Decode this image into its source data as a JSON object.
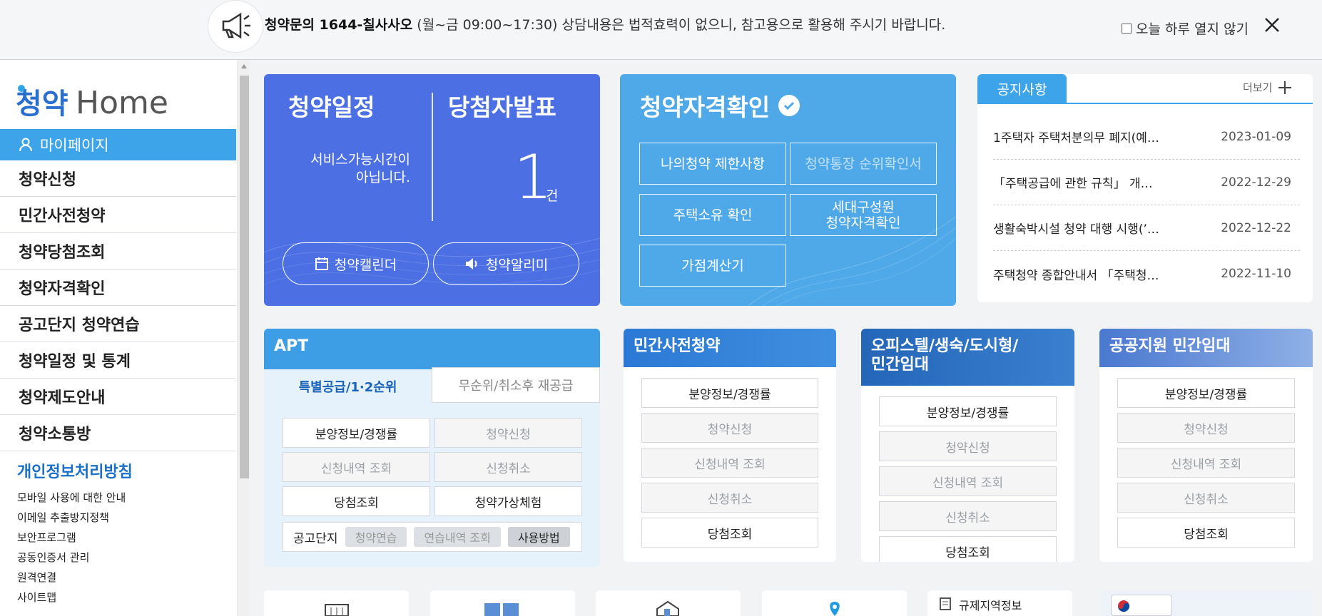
{
  "banner": {
    "headline": "청약문의 1644-칠사사오",
    "hours": "(월~금 09:00~17:30)",
    "message": "상담내용은 법적효력이 없으니, 참고용으로 활용해 주시기 바랍니다.",
    "no_open_label": "오늘 하루 열지 않기"
  },
  "sidebar": {
    "logo_text": "청약Home",
    "mypage_label": "마이페이지",
    "menu": [
      "청약신청",
      "민간사전청약",
      "청약당첨조회",
      "청약자격확인",
      "공고단지 청약연습",
      "청약일정 및 통계",
      "청약제도안내",
      "청약소통방"
    ],
    "privacy_label": "개인정보처리방침",
    "sublinks": [
      "모바일 사용에 대한 안내",
      "이메일 추출방지정책",
      "보안프로그램",
      "공동인증서 관리",
      "원격연결",
      "사이트맵"
    ]
  },
  "schedule": {
    "title": "청약일정",
    "service_msg_1": "서비스가능시간이",
    "service_msg_2": "아닙니다.",
    "winners_title": "당첨자발표",
    "winners_count": "1",
    "winners_unit": "건",
    "calendar_label": "청약캘린더",
    "alarm_label": "청약알리미"
  },
  "qualification": {
    "title": "청약자격확인",
    "buttons": [
      "나의청약 제한사항",
      "청약통장 순위확인서",
      "주택소유 확인",
      "세대구성원\n청약자격확인",
      "가점계산기"
    ]
  },
  "notices": {
    "tab_label": "공지사항",
    "more_label": "더보기",
    "items": [
      {
        "title": "1주택자 주택처분의무 폐지(예…",
        "date": "2023-01-09"
      },
      {
        "title": "「주택공급에 관한 규칙」 개…",
        "date": "2022-12-29"
      },
      {
        "title": "생활숙박시설 청약 대행 시행(’…",
        "date": "2022-12-22"
      },
      {
        "title": "주택청약 종합안내서 「주택청…",
        "date": "2022-11-10"
      }
    ]
  },
  "apt": {
    "title": "APT",
    "tab_active": "특별공급/1·2순위",
    "tab_inactive": "무순위/취소후 재공급",
    "btn_info": "분양정보/경쟁률",
    "btn_apply": "청약신청",
    "btn_history": "신청내역 조회",
    "btn_cancel": "신청취소",
    "btn_result": "당첨조회",
    "btn_virtual": "청약가상체험",
    "complex_label": "공고단지",
    "tag_practice": "청약연습",
    "tag_practice_history": "연습내역 조회",
    "tag_howto": "사용방법"
  },
  "categories": [
    {
      "title": "민간사전청약",
      "btns": [
        "분양정보/경쟁률",
        "청약신청",
        "신청내역 조회",
        "신청취소",
        "당첨조회"
      ]
    },
    {
      "title": "오피스텔/생숙/도시형/\n민간임대",
      "btns": [
        "분양정보/경쟁률",
        "청약신청",
        "신청내역 조회",
        "신청취소",
        "당첨조회"
      ]
    },
    {
      "title": "공공지원 민간임대",
      "btns": [
        "분양정보/경쟁률",
        "청약신청",
        "신청내역 조회",
        "신청취소",
        "당첨조회"
      ]
    }
  ],
  "bottom": {
    "regulation_label": "규제지역정보"
  },
  "colors": {
    "primary": "#3ea4ea",
    "schedule_bg": "#4c70e4",
    "qual_bg": "#4fa9e8",
    "apt_head": "#3d9ee6"
  }
}
